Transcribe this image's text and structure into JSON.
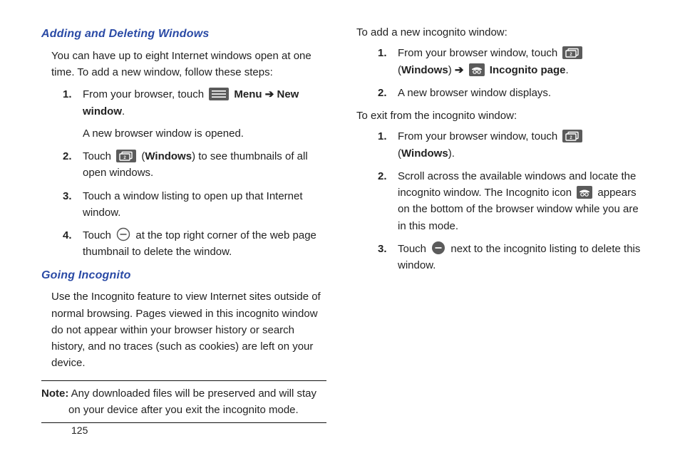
{
  "left_column": {
    "heading_add_delete": "Adding and Deleting Windows",
    "para_intro": "You can have up to eight Internet windows open at one time. To add a new window, follow these steps:",
    "steps_add_delete": [
      {
        "pre": "From your browser, touch ",
        "icon": "menu",
        "post": " ",
        "bold1": "Menu",
        "arrow": " ➔ ",
        "bold2": "New window",
        "tail": ".",
        "sub": "A new browser window is opened."
      },
      {
        "pre": "Touch ",
        "icon": "windows",
        "post": " (",
        "bold1": "Windows",
        "tail": ") to see thumbnails of all open windows."
      },
      {
        "pre": "Touch a window listing to open up that Internet window."
      },
      {
        "pre": "Touch ",
        "icon": "minus",
        "tail": " at the top right corner of the web page thumbnail to delete the window."
      }
    ],
    "heading_incognito": "Going Incognito",
    "para_incognito": "Use the Incognito feature to view Internet sites outside of normal browsing. Pages viewed in this incognito window do not appear within your browser history or search history, and no traces (such as cookies) are left on your device.",
    "note_label": "Note:",
    "note_body": " Any downloaded files will be preserved and will stay on your device after you exit the incognito mode."
  },
  "right_column": {
    "lead_add": "To add a new incognito window:",
    "steps_add_incognito": [
      {
        "pre": "From your browser window, touch ",
        "icon": "windows",
        "post": " (",
        "bold1": "Windows",
        "tail_segments": [
          {
            "text": ") "
          },
          {
            "text": "➔",
            "class": "arrow"
          },
          {
            "text": " "
          },
          {
            "icon": "incognito"
          },
          {
            "text": " "
          },
          {
            "text": "Incognito page",
            "class": "bold"
          },
          {
            "text": "."
          }
        ]
      },
      {
        "pre": "A new browser window displays."
      }
    ],
    "lead_exit": "To exit from the incognito window:",
    "steps_exit_incognito": [
      {
        "pre": "From your browser window, touch ",
        "icon": "windows",
        "post": " (",
        "bold1": "Windows",
        "tail": ")."
      },
      {
        "pre": "Scroll across the available windows and locate the incognito window. The Incognito icon ",
        "icon": "incognito",
        "tail": " appears on the bottom of the browser window while you are in this mode."
      },
      {
        "pre": "Touch ",
        "icon": "minus-dark",
        "tail": " next to the incognito listing to delete this window."
      }
    ]
  },
  "page_number": "125"
}
